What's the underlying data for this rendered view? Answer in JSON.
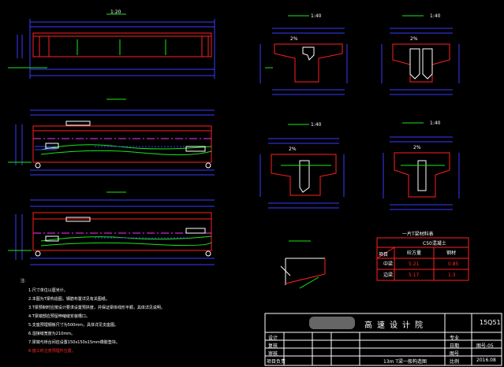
{
  "colors": {
    "background": "#000000",
    "outline": "#ff2020",
    "dimension": "#3a3aff",
    "text": "#ffffff",
    "highlight_green": "#19e619",
    "centerline": "#ff30ff"
  },
  "drawing": {
    "elevation_scale": "1:20",
    "section_scale_1": "1:40",
    "section_scale_2": "1:40",
    "section_scale_3": "1:40",
    "section_scale_4": "1:40",
    "section_slope_1": "2%",
    "section_slope_2": "2%",
    "section_slope_3": "2%",
    "section_slope_4": "2%"
  },
  "notes": {
    "heading": "注:",
    "items": [
      "1.尺寸单位以厘米计。",
      "2.本图为T梁构造图，钢筋布置详见有关图纸。",
      "3.T梁预制时应按设计要求设置预拱度，并保证梁体线形平顺，具体详见说明。",
      "4.T梁端部应预留伸缩缝安装槽口。",
      "5.支座预埋钢板尺寸为500mm，具体详见支座图。",
      "6.湿接缝宽度为210mm。",
      "7.梁端与桥台间应设置150x150x15mm橡胶垫块。"
    ],
    "warning": "8.施工时注意预埋件位置。"
  },
  "quantity_table": {
    "title": "一片T梁材料表",
    "concrete_header": "C50混凝土",
    "col_headers": [
      "项目",
      "砼方量",
      "钢材"
    ],
    "rows": [
      {
        "label": "中梁",
        "v1": "5.21",
        "v2": "0.85"
      },
      {
        "label": "边梁",
        "v1": "5.17",
        "v2": "1.3"
      }
    ]
  },
  "title_block": {
    "company": "高速设计院",
    "project_code": "15Q51",
    "drawing_no": "图号-05",
    "date": "2016.08",
    "drawing_title": "13m T梁一般构造图",
    "labels": [
      "设计",
      "复核",
      "审核",
      "项目负责"
    ],
    "sub_labels": [
      "专业",
      "日期",
      "图号",
      "比例"
    ]
  }
}
